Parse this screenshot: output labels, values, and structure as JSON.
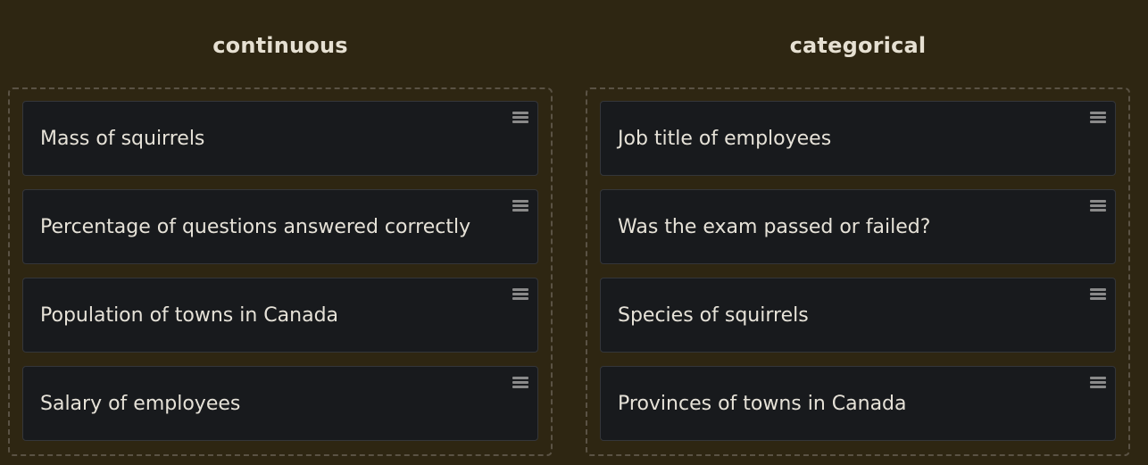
{
  "columns": [
    {
      "title": "continuous",
      "items": [
        {
          "label": "Mass of squirrels",
          "icon": "drag-handle-icon"
        },
        {
          "label": "Percentage of questions answered correctly",
          "icon": "drag-handle-icon"
        },
        {
          "label": "Population of towns in Canada",
          "icon": "drag-handle-icon"
        },
        {
          "label": "Salary of employees",
          "icon": "drag-handle-icon"
        }
      ]
    },
    {
      "title": "categorical",
      "items": [
        {
          "label": "Job title of employees",
          "icon": "drag-handle-icon"
        },
        {
          "label": "Was the exam passed or failed?",
          "icon": "drag-handle-icon"
        },
        {
          "label": "Species of squirrels",
          "icon": "drag-handle-icon"
        },
        {
          "label": "Provinces of towns in Canada",
          "icon": "drag-handle-icon"
        }
      ]
    }
  ],
  "colors": {
    "background": "#2e2612",
    "card": "#181a1d",
    "title_text": "#e6e0d2",
    "card_text": "#e6e2d8",
    "dropzone_border": "#5a5244"
  }
}
